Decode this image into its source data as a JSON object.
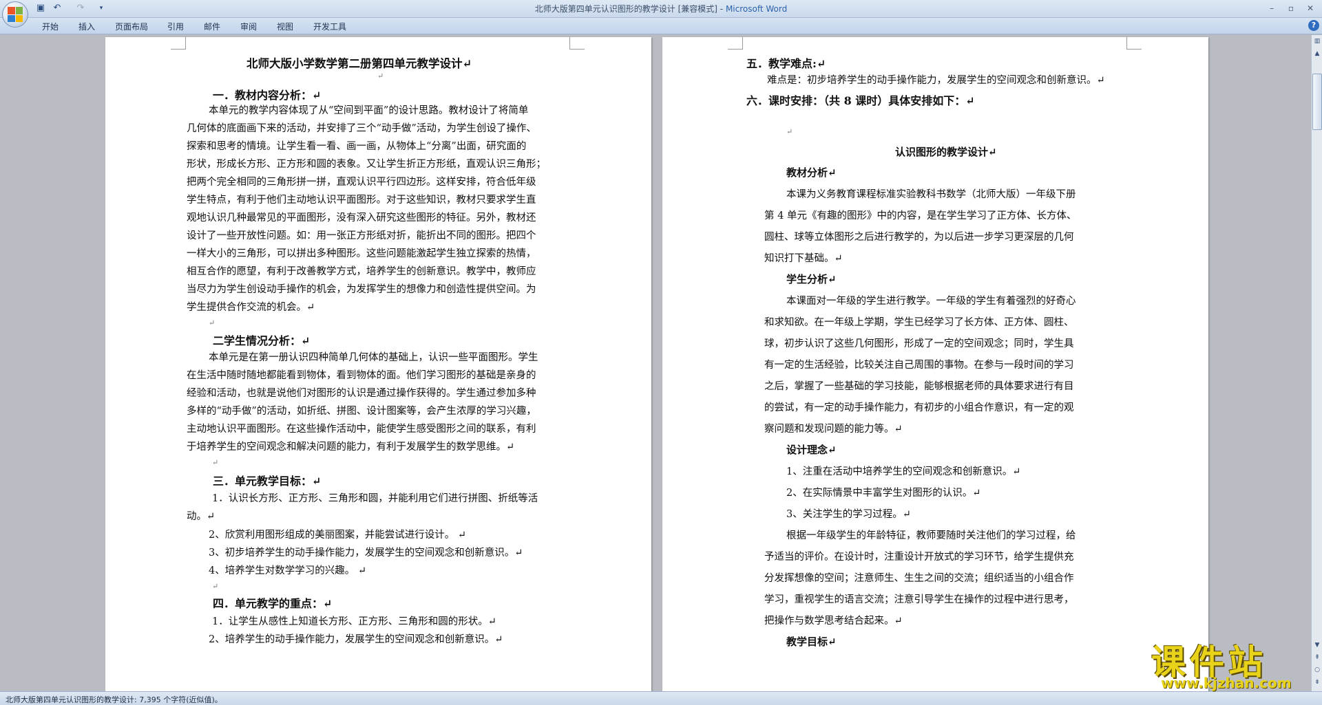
{
  "window": {
    "doc_name": "北师大版第四单元认识图形的教学设计 [兼容模式]",
    "separator": " - ",
    "app_name": "Microsoft Word",
    "minimize": "–",
    "restore": "▫",
    "close": "✕"
  },
  "quick_access": {
    "save_icon": "save-icon",
    "undo_icon": "undo-icon",
    "redo_icon": "redo-icon",
    "customize_icon": "dropdown-icon"
  },
  "ribbon": {
    "tabs": [
      "开始",
      "插入",
      "页面布局",
      "引用",
      "邮件",
      "审阅",
      "视图",
      "开发工具"
    ],
    "help": "?"
  },
  "colors": {
    "accent": "#2b62a9",
    "watermark": "#e8d21a"
  },
  "left_page": {
    "title": "北师大版小学数学第二册第四单元教学设计↵",
    "blank1": "↵",
    "sec1_heading": "一．教材内容分析：↵",
    "sec1_lines": [
      "本单元的教学内容体现了从“空间到平面”的设计思路。教材设计了将简单",
      "几何体的底面画下来的活动，并安排了三个“动手做”活动，为学生创设了操作、",
      "探索和思考的情境。让学生看一看、画一画，从物体上“分离”出面，研究面的",
      "形状，形成长方形、正方形和圆的表象。又让学生折正方形纸，直观认识三角形；",
      "把两个完全相同的三角形拼一拼，直观认识平行四边形。这样安排，符合低年级",
      "学生特点，有利于他们主动地认识平面图形。对于这些知识，教材只要求学生直",
      "观地认识几种最常见的平面图形，没有深入研究这些图形的特征。另外，教材还",
      "设计了一些开放性问题。如：用一张正方形纸对折，能折出不同的图形。把四个",
      "一样大小的三角形，可以拼出多种图形。这些问题能激起学生独立探索的热情，",
      "相互合作的愿望，有利于改善教学方式，培养学生的创新意识。教学中，教师应",
      "当尽力为学生创设动手操作的机会，为发挥学生的想像力和创造性提供空间。为",
      "学生提供合作交流的机会。↵"
    ],
    "blank2": "↵",
    "sec2_heading": "二学生情况分析：↵",
    "sec2_lines": [
      "本单元是在第一册认识四种简单几何体的基础上，认识一些平面图形。学生",
      "在生活中随时随地都能看到物体，看到物体的面。他们学习图形的基础是亲身的",
      "经验和活动，也就是说他们对图形的认识是通过操作获得的。学生通过参加多种",
      "多样的“动手做”的活动，如折纸、拼图、设计图案等，会产生浓厚的学习兴趣，",
      "主动地认识平面图形。在这些操作活动中，能使学生感受图形之间的联系，有利",
      "于培养学生的空间观念和解决问题的能力，有利于发展学生的数学思维。↵"
    ],
    "blank3": "↵",
    "sec3_heading": "三．单元教学目标：↵",
    "sec3_lines": [
      "1．认识长方形、正方形、三角形和圆，并能利用它们进行拼图、折纸等活",
      "动。↵",
      "2、欣赏利用图形组成的美丽图案，并能尝试进行设计。 ↵",
      "3、初步培养学生的动手操作能力，发展学生的空间观念和创新意识。↵",
      "4、培养学生对数学学习的兴趣。 ↵"
    ],
    "blank4": "↵",
    "sec4_heading": "四．单元教学的重点：↵",
    "sec4_lines": [
      "1．让学生从感性上知道长方形、正方形、三角形和圆的形状。↵",
      "2、培养学生的动手操作能力，发展学生的空间观念和创新意识。↵"
    ]
  },
  "right_page": {
    "sec5_heading": "五．教学难点:↵",
    "sec5_line": "难点是：初步培养学生的动手操作能力，发展学生的空间观念和创新意识。↵",
    "sec6_heading": "六．课时安排：（共 8 课时）具体安排如下：↵",
    "blank1": "↵",
    "plan_title": "认识图形的教学设计↵",
    "analysis_heading": "教材分析↵",
    "analysis_lines": [
      "本课为义务教育课程标准实验教科书数学（北师大版）一年级下册",
      "第 4 单元《有趣的图形》中的内容，是在学生学习了正方体、长方体、",
      "圆柱、球等立体图形之后进行教学的，为以后进一步学习更深层的几何",
      "知识打下基础。↵"
    ],
    "student_heading": "学生分析↵",
    "student_lines": [
      "本课面对一年级的学生进行教学。一年级的学生有着强烈的好奇心",
      "和求知欲。在一年级上学期，学生已经学习了长方体、正方体、圆柱、",
      "球，初步认识了这些几何图形，形成了一定的空间观念；同时，学生具",
      "有一定的生活经验，比较关注自己周围的事物。在参与一段时间的学习",
      "之后，掌握了一些基础的学习技能，能够根据老师的具体要求进行有目",
      "的尝试，有一定的动手操作能力，有初步的小组合作意识，有一定的观",
      "察问题和发现问题的能力等。↵"
    ],
    "concept_heading": "设计理念↵",
    "concept_items": [
      "1、注重在活动中培养学生的空间观念和创新意识。↵",
      "2、在实际情景中丰富学生对图形的认识。↵",
      "3、关注学生的学习过程。↵"
    ],
    "concept_lines": [
      "根据一年级学生的年龄特征，教师要随时关注他们的学习过程，给",
      "予适当的评价。在设计时，注重设计开放式的学习环节，给学生提供充",
      "分发挥想像的空间；注意师生、生生之间的交流；组织适当的小组合作",
      "学习，重视学生的语言交流；注意引导学生在操作的过程中进行思考，",
      "把操作与数学思考结合起来。↵"
    ],
    "goal_heading": "教学目标↵"
  },
  "status": {
    "text": "北师大版第四单元认识图形的教学设计: 7,395 个字符(近似值)。"
  },
  "watermark": {
    "main": "课件站",
    "url": "www.kjzhan.com"
  }
}
